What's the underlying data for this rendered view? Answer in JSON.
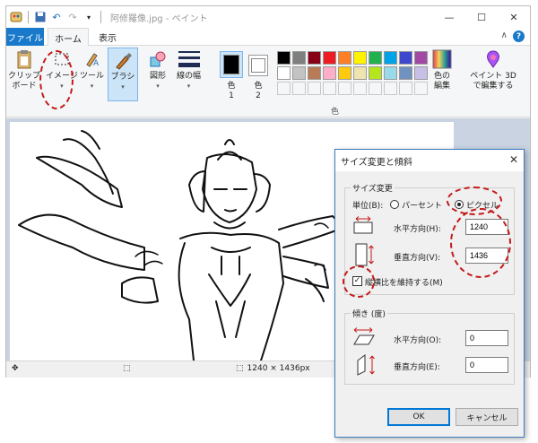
{
  "window": {
    "title": "阿修羅像.jpg - ペイント",
    "minimize": "—",
    "maximize": "☐",
    "close": "✕"
  },
  "tabs": {
    "file": "ファイル",
    "home": "ホーム",
    "view": "表示",
    "collapse": "∧"
  },
  "ribbon": {
    "clipboard": "クリップ\nボード",
    "image": "イメージ",
    "tools": "ツール",
    "brush": "ブラシ",
    "shapes": "図形",
    "line_width": "線の幅",
    "color1": "色\n1",
    "color2": "色\n2",
    "edit_colors": "色の\n編集",
    "paint3d": "ペイント 3D\nで編集する",
    "colors_group": "色"
  },
  "palette": [
    "#000000",
    "#7f7f7f",
    "#880015",
    "#ed1c24",
    "#ff7f27",
    "#fff200",
    "#22b14c",
    "#00a2e8",
    "#3f48cc",
    "#a349a4",
    "#ffffff",
    "#c3c3c3",
    "#b97a57",
    "#ffaec9",
    "#ffc90e",
    "#efe4b0",
    "#b5e61d",
    "#99d9ea",
    "#7092be",
    "#c8bfe7"
  ],
  "status": {
    "size": "1240 × 1436px"
  },
  "dialog": {
    "title": "サイズ変更と傾斜",
    "resize_group": "サイズ変更",
    "unit_label": "単位(B):",
    "percent": "パーセント",
    "pixel": "ピクセル",
    "horizontal_label": "水平方向(H):",
    "horizontal_value": "1240",
    "vertical_label": "垂直方向(V):",
    "vertical_value": "1436",
    "keep_ratio": "縦横比を維持する(M)",
    "skew_group": "傾き (度)",
    "skew_h_label": "水平方向(O):",
    "skew_h_value": "0",
    "skew_v_label": "垂直方向(E):",
    "skew_v_value": "0",
    "ok": "OK",
    "cancel": "キャンセル"
  },
  "colors": {
    "accent": "#1979ca",
    "annotation": "#c41a1a"
  }
}
